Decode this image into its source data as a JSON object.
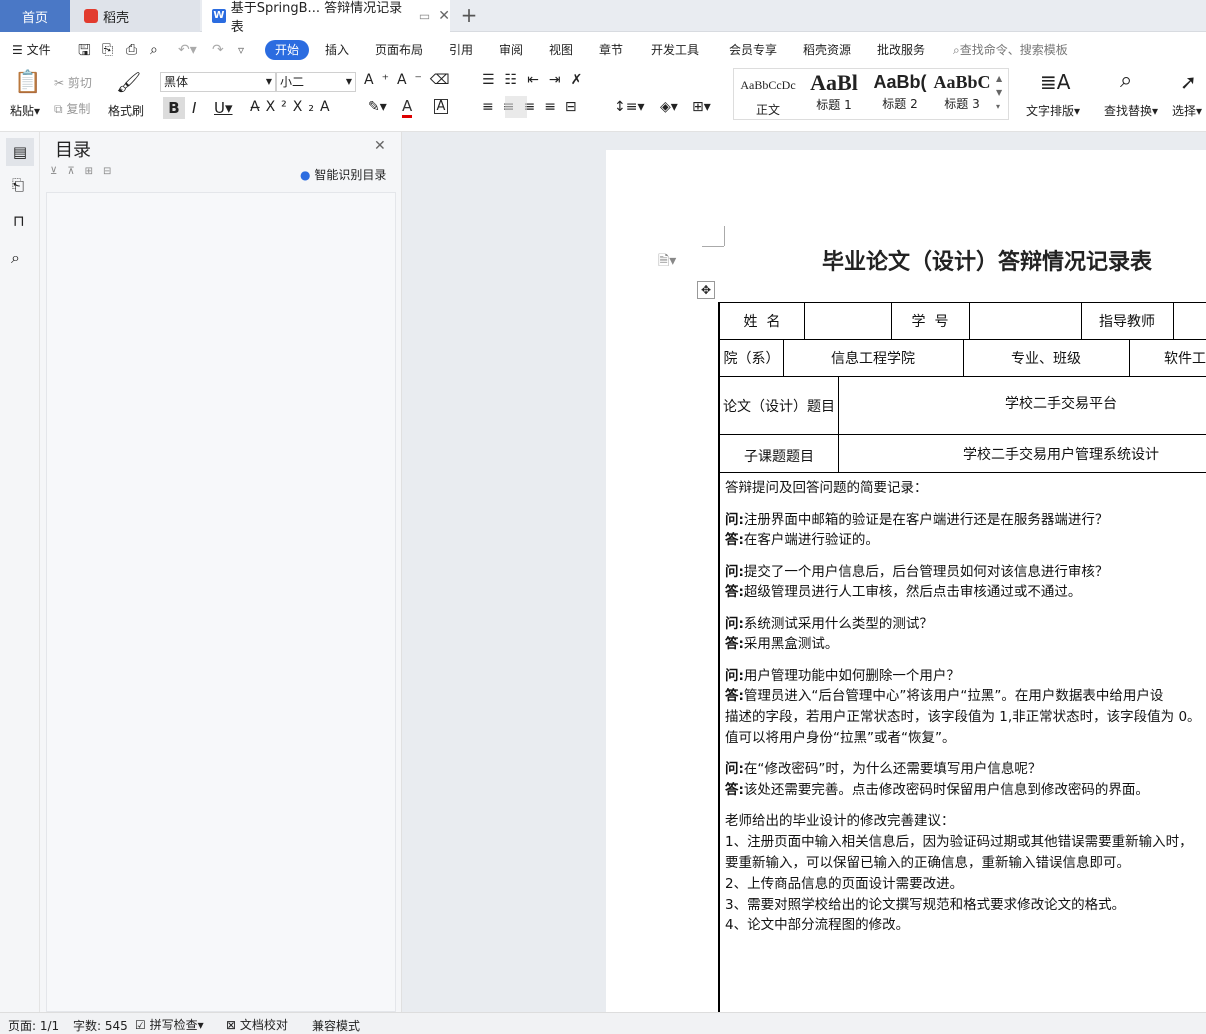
{
  "tabs": {
    "home": "首页",
    "daoke": "稻壳",
    "doc": "基于SpringB... 答辩情况记录表",
    "add": "+"
  },
  "menu": {
    "file": "文件",
    "items": [
      "开始",
      "插入",
      "页面布局",
      "引用",
      "审阅",
      "视图",
      "章节",
      "开发工具",
      "会员专享",
      "稻壳资源",
      "批改服务"
    ],
    "search_placeholder": "查找命令、搜索模板"
  },
  "ribbon": {
    "paste": "粘贴",
    "cut": "剪切",
    "copy": "复制",
    "format_painter": "格式刷",
    "font_name": "黑体",
    "font_size": "小二",
    "styles": [
      {
        "preview": "AaBbCcDc",
        "name": "正文"
      },
      {
        "preview": "AaBl",
        "name": "标题 1"
      },
      {
        "preview": "AaBb(",
        "name": "标题 2"
      },
      {
        "preview": "AaBbC",
        "name": "标题 3"
      }
    ],
    "text_layout": "文字排版",
    "find_replace": "查找替换",
    "select": "选择"
  },
  "nav_pane": {
    "title": "目录",
    "smart_toc": "智能识别目录"
  },
  "document": {
    "title": "毕业论文（设计）答辩情况记录表",
    "table": {
      "name_label": "姓  名",
      "student_id_label": "学  号",
      "advisor_label": "指导教师",
      "dept_label": "院（系）",
      "dept_value": "信息工程学院",
      "major_label": "专业、班级",
      "major_value": "软件工",
      "thesis_label": "论文（设计）题目",
      "thesis_value": "学校二手交易平台",
      "sub_label": "子课题题目",
      "sub_value": "学校二手交易用户管理系统设计"
    },
    "qa_intro": "答辩提问及回答问题的简要记录：",
    "q_prefix": "问:",
    "a_prefix": "答:",
    "qa": [
      {
        "q": "注册界面中邮箱的验证是在客户端进行还是在服务器端进行？",
        "a": [
          "在客户端进行验证的。"
        ]
      },
      {
        "q": "提交了一个用户信息后，后台管理员如何对该信息进行审核？",
        "a": [
          "超级管理员进行人工审核，然后点击审核通过或不通过。"
        ]
      },
      {
        "q": "系统测试采用什么类型的测试？",
        "a": [
          "采用黑盒测试。"
        ]
      },
      {
        "q": "用户管理功能中如何删除一个用户？",
        "a": [
          "管理员进入“后台管理中心”将该用户“拉黑”。在用户数据表中给用户设",
          "描述的字段，若用户正常状态时，该字段值为 1,非正常状态时，该字段值为 0。",
          "值可以将用户身份“拉黑”或者“恢复”。"
        ]
      },
      {
        "q": "在“修改密码”时，为什么还需要填写用户信息呢？",
        "a": [
          "该处还需要完善。点击修改密码时保留用户信息到修改密码的界面。"
        ]
      }
    ],
    "suggest_title": "老师给出的毕业设计的修改完善建议：",
    "suggestions": [
      "1、注册页面中输入相关信息后，因为验证码过期或其他错误需要重新输入时，",
      "要重新输入，可以保留已输入的正确信息，重新输入错误信息即可。",
      "2、上传商品信息的页面设计需要改进。",
      "3、需要对照学校给出的论文撰写规范和格式要求修改论文的格式。",
      "4、论文中部分流程图的修改。"
    ]
  },
  "status": {
    "page": "页面: 1/1",
    "words": "字数: 545",
    "spell": "拼写检查",
    "proof": "文档校对",
    "compat": "兼容模式"
  },
  "colors": {
    "accent": "#2b6ce0",
    "home_tab": "#4a78c6"
  }
}
